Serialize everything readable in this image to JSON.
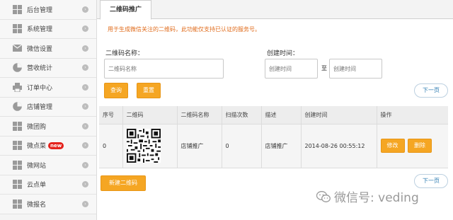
{
  "sidebar": {
    "items": [
      {
        "label": "后台管理",
        "icon": "grid-icon"
      },
      {
        "label": "系统管理",
        "icon": "grid-icon"
      },
      {
        "label": "微信设置",
        "icon": "mail-icon"
      },
      {
        "label": "营收统计",
        "icon": "pie-icon"
      },
      {
        "label": "订单中心",
        "icon": "printer-icon"
      },
      {
        "label": "店铺管理",
        "icon": "pie-icon"
      },
      {
        "label": "微团购",
        "icon": "grid-icon"
      },
      {
        "label": "微点菜",
        "icon": "grid-icon",
        "badge": "new"
      },
      {
        "label": "微网站",
        "icon": "grid-icon"
      },
      {
        "label": "云点单",
        "icon": "grid-icon"
      },
      {
        "label": "微报名",
        "icon": "grid-icon"
      }
    ]
  },
  "tab": {
    "label": "二维码推广"
  },
  "notice": "用于生成微信关注的二维码，此功能仅支持已认证的服务号。",
  "form": {
    "name_label": "二维码名称：",
    "name_placeholder": "二维码名称",
    "time_label": "创建时间：",
    "time_from_placeholder": "创建时间",
    "time_sep": "至",
    "time_to_placeholder": "创建时间",
    "query_button": "查询",
    "reset_button": "重置"
  },
  "pager": {
    "next_top": "下一页",
    "next_bottom": "下一页"
  },
  "table": {
    "headers": [
      "序号",
      "二维码",
      "二维码名称",
      "扫描次数",
      "描述",
      "创建时间",
      "操作"
    ],
    "rows": [
      {
        "index": "0",
        "name": "店铺推广",
        "scans": "0",
        "desc": "店铺推广",
        "created": "2014-08-26 00:55:12",
        "edit": "修改",
        "delete": "删除"
      }
    ]
  },
  "new_button": "新建二维码",
  "watermark": "微信号: veding",
  "colors": {
    "accent": "#f5a623",
    "notice": "#e06b1b",
    "badge": "#e4221c",
    "link": "#2a7ab0"
  }
}
